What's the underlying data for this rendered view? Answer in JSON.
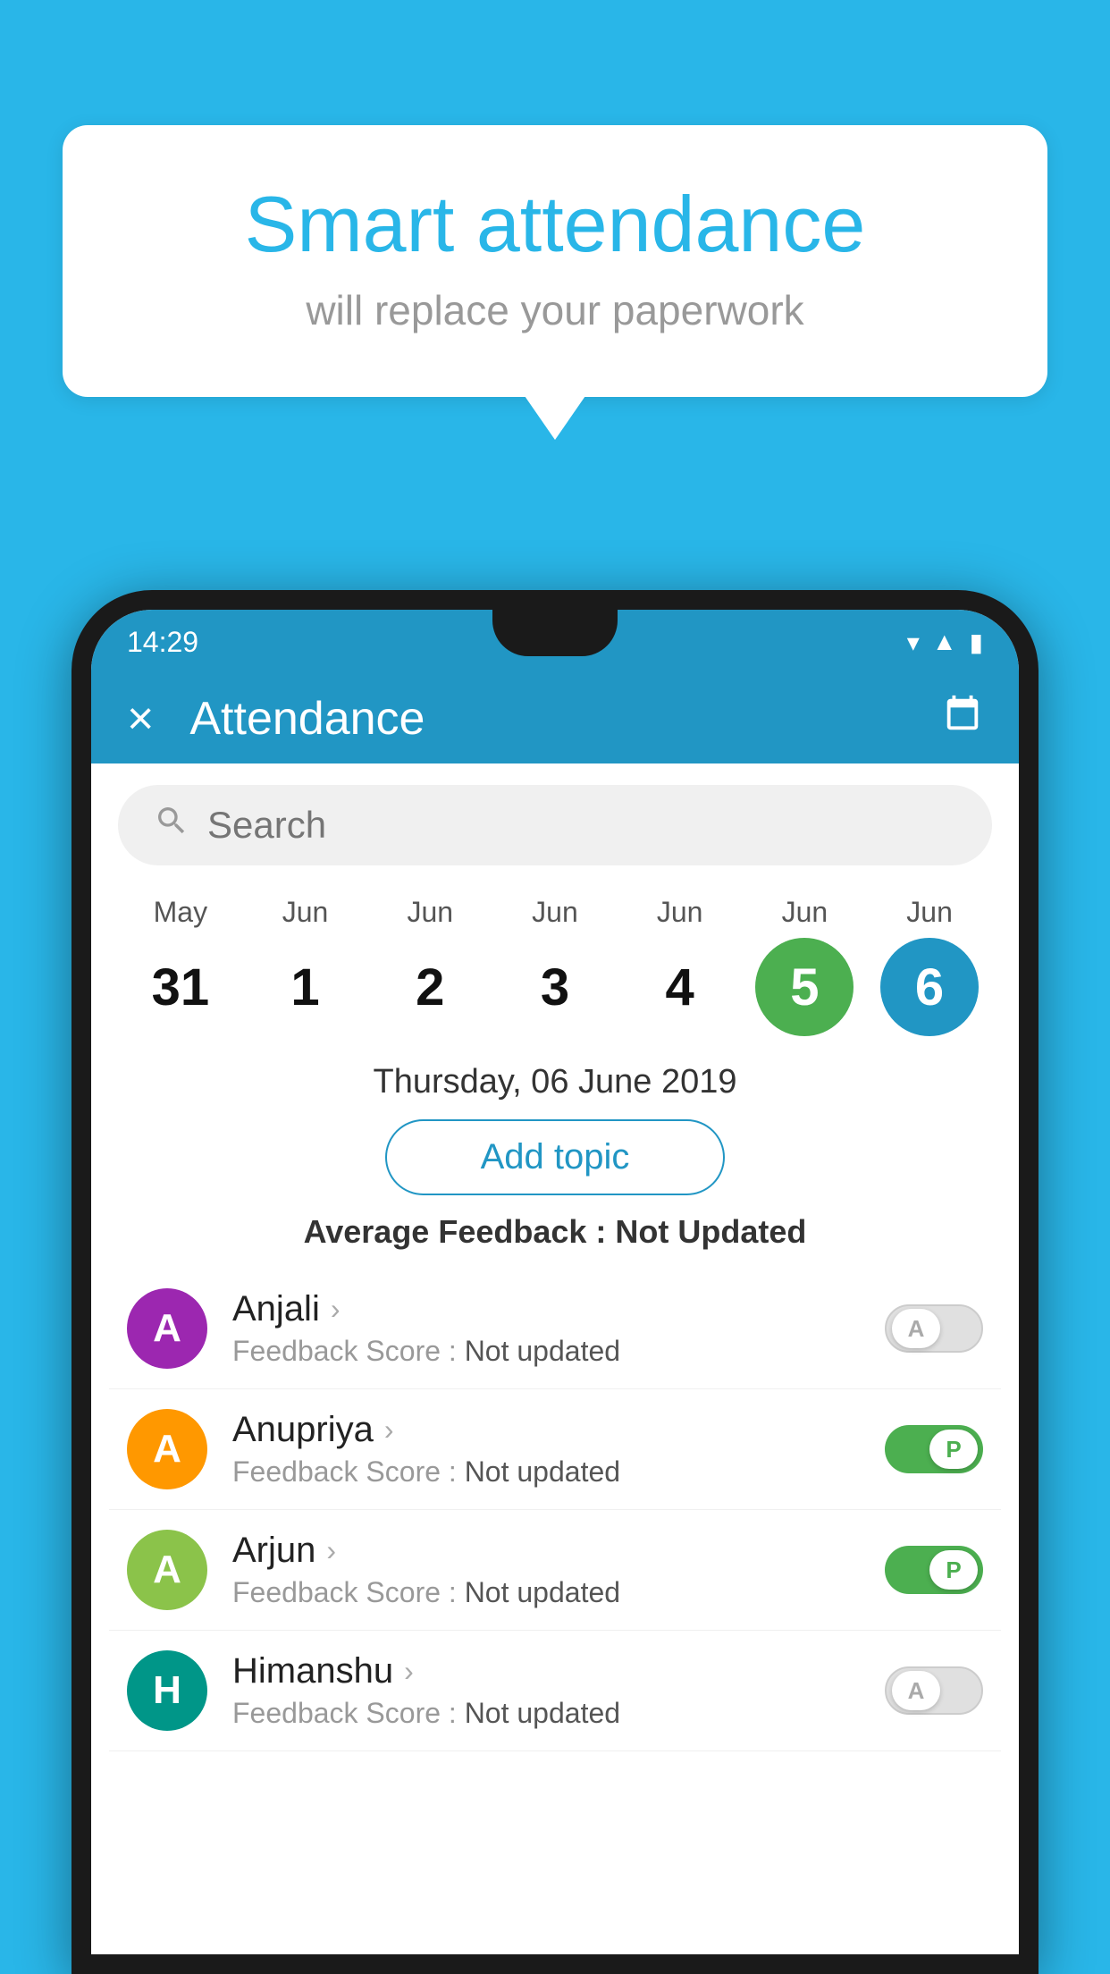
{
  "background_color": "#29b6e8",
  "speech_bubble": {
    "title": "Smart attendance",
    "subtitle": "will replace your paperwork"
  },
  "status_bar": {
    "time": "14:29",
    "icons": [
      "wifi",
      "signal",
      "battery"
    ]
  },
  "header": {
    "title": "Attendance",
    "close_label": "×",
    "calendar_icon": "📅"
  },
  "search": {
    "placeholder": "Search"
  },
  "calendar": {
    "days": [
      {
        "month": "May",
        "date": "31",
        "highlight": ""
      },
      {
        "month": "Jun",
        "date": "1",
        "highlight": ""
      },
      {
        "month": "Jun",
        "date": "2",
        "highlight": ""
      },
      {
        "month": "Jun",
        "date": "3",
        "highlight": ""
      },
      {
        "month": "Jun",
        "date": "4",
        "highlight": ""
      },
      {
        "month": "Jun",
        "date": "5",
        "highlight": "green"
      },
      {
        "month": "Jun",
        "date": "6",
        "highlight": "blue"
      }
    ]
  },
  "selected_date": "Thursday, 06 June 2019",
  "add_topic_label": "Add topic",
  "avg_feedback_label": "Average Feedback :",
  "avg_feedback_value": "Not Updated",
  "students": [
    {
      "name": "Anjali",
      "initial": "A",
      "avatar_color": "avatar-purple",
      "feedback_label": "Feedback Score :",
      "feedback_value": "Not updated",
      "toggle": "off",
      "toggle_letter": "A"
    },
    {
      "name": "Anupriya",
      "initial": "A",
      "avatar_color": "avatar-orange",
      "feedback_label": "Feedback Score :",
      "feedback_value": "Not updated",
      "toggle": "on",
      "toggle_letter": "P"
    },
    {
      "name": "Arjun",
      "initial": "A",
      "avatar_color": "avatar-light-green",
      "feedback_label": "Feedback Score :",
      "feedback_value": "Not updated",
      "toggle": "on",
      "toggle_letter": "P"
    },
    {
      "name": "Himanshu",
      "initial": "H",
      "avatar_color": "avatar-teal",
      "feedback_label": "Feedback Score :",
      "feedback_value": "Not updated",
      "toggle": "off",
      "toggle_letter": "A"
    }
  ]
}
